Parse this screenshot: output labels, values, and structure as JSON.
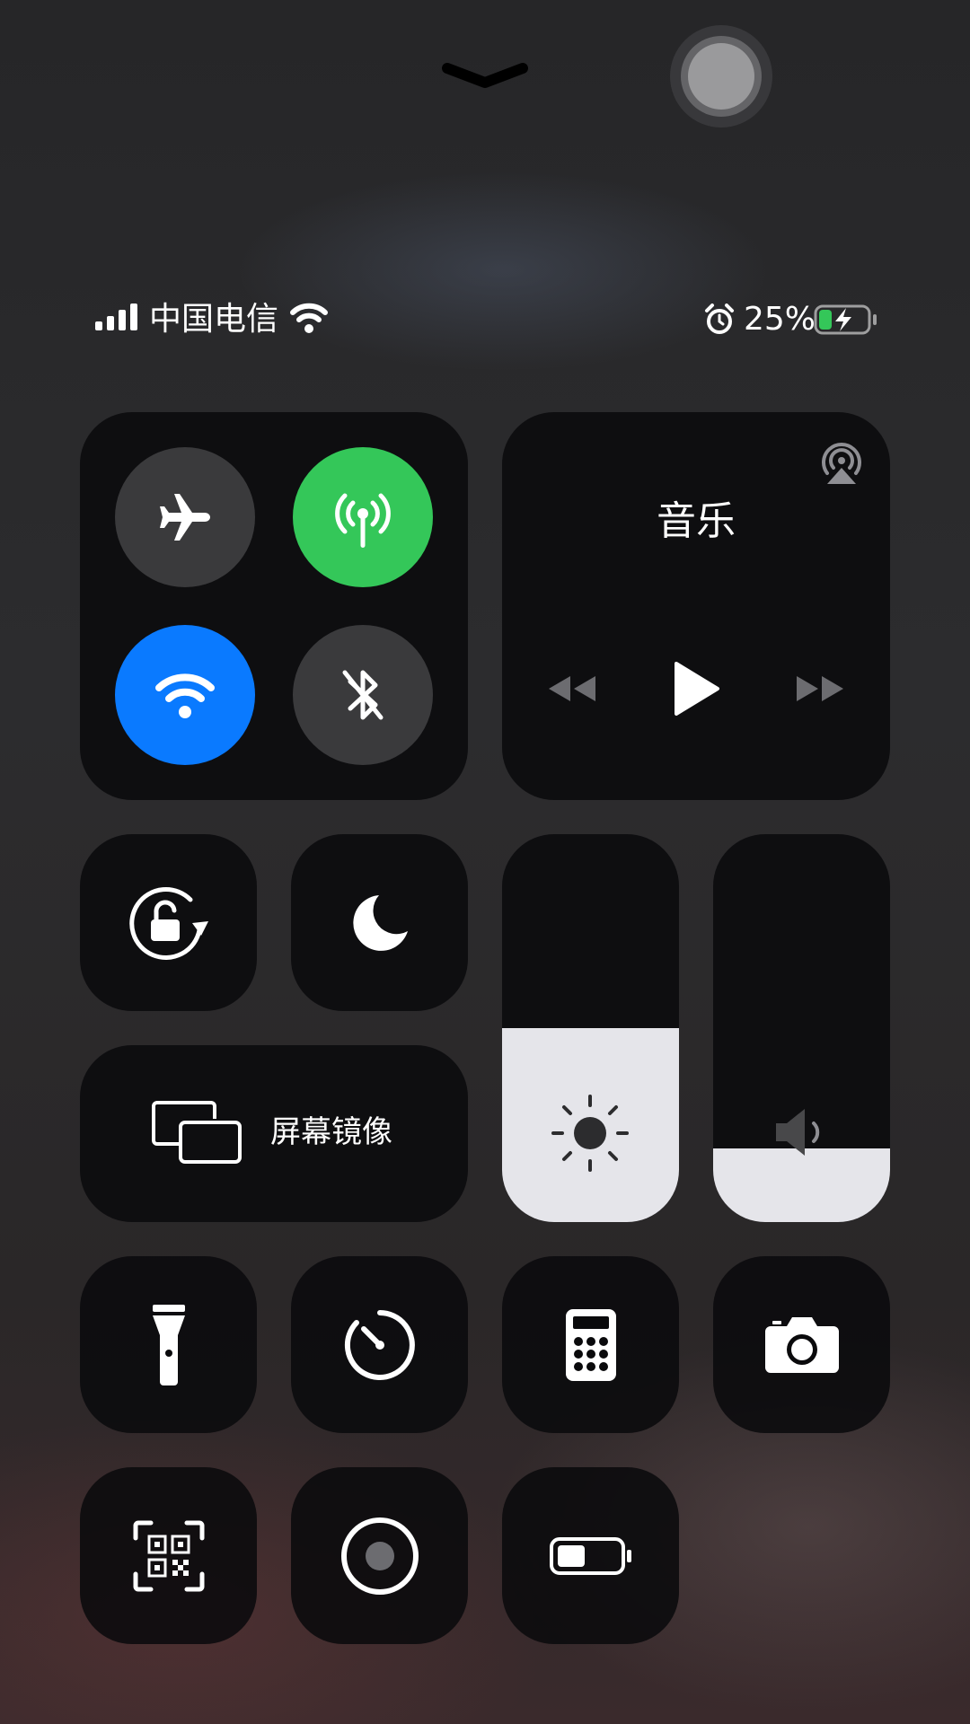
{
  "status_bar": {
    "carrier": "中国电信",
    "battery_percent": "25%",
    "battery_level": 0.25,
    "battery_charging": true
  },
  "connectivity": {
    "airplane_mode": false,
    "cellular_data": true,
    "wifi": true,
    "bluetooth": false,
    "colors": {
      "cellular_on": "#34c759",
      "wifi_on": "#0a7aff",
      "off": "#3a3a3c"
    }
  },
  "music": {
    "title": "音乐",
    "icons": [
      "airplay-icon",
      "rewind-icon",
      "play-icon",
      "fast-forward-icon"
    ]
  },
  "screen_mirroring": {
    "label": "屏幕镜像"
  },
  "brightness": {
    "level": 0.5
  },
  "volume": {
    "level": 0.19
  },
  "shortcuts": [
    "orientation-lock-icon",
    "moon-icon",
    "flashlight-icon",
    "timer-icon",
    "calculator-icon",
    "camera-icon",
    "qr-code-icon",
    "accessibility-shortcut-icon",
    "low-power-mode-icon"
  ]
}
